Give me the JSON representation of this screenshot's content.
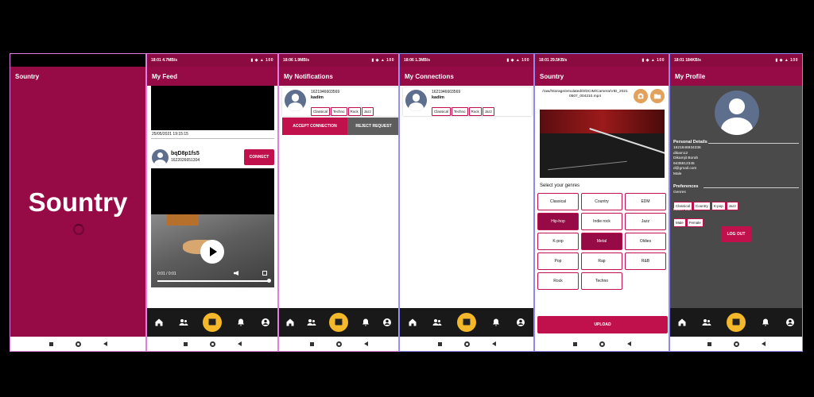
{
  "screens": {
    "splash": {
      "title": "Sountry",
      "logo": "Sountry"
    },
    "feed": {
      "status_time": "18:01",
      "status_speed": "4.7MB/s",
      "title": "My Feed",
      "post_date": "25/05/2021 19:15:15",
      "user_name": "bqD8p1fs5",
      "user_phone": "1622026651304",
      "connect_label": "CONNECT",
      "video_time": "0:01 / 0:01"
    },
    "notifications": {
      "status_time": "18:06",
      "status_speed": "1.9MB/s",
      "title": "My Notifications",
      "phone": "1621946603569",
      "name": "kadim",
      "genres": [
        "Classical",
        "Techno",
        "Rock",
        "Jazz"
      ],
      "accept_label": "ACCEPT CONNECTION",
      "reject_label": "REJECT REQUEST"
    },
    "connections": {
      "status_time": "18:06",
      "status_speed": "1.3MB/s",
      "title": "My Connections",
      "phone": "1621946603569",
      "name": "kadim",
      "genres": [
        "Classical",
        "Techno",
        "Rock",
        "Jazz"
      ]
    },
    "upload": {
      "status_time": "18:01",
      "status_speed": "29.5KB/s",
      "title": "Sountry",
      "file_path": "/raw//storage/emulated/0/DCIM/Camera/VID_20210507_004210.mp4",
      "select_label": "Select your genres",
      "genres": [
        {
          "label": "Classical",
          "selected": false
        },
        {
          "label": "Country",
          "selected": false
        },
        {
          "label": "EDM",
          "selected": false
        },
        {
          "label": "Hip-hop",
          "selected": true
        },
        {
          "label": "Indie rock",
          "selected": false
        },
        {
          "label": "Jazz",
          "selected": false
        },
        {
          "label": "K-pop",
          "selected": false
        },
        {
          "label": "Metal",
          "selected": true
        },
        {
          "label": "Oldies",
          "selected": false
        },
        {
          "label": "Pop",
          "selected": false
        },
        {
          "label": "Rap",
          "selected": false
        },
        {
          "label": "R&B",
          "selected": false
        },
        {
          "label": "Rock",
          "selected": false
        },
        {
          "label": "Techno",
          "selected": false
        }
      ],
      "upload_label": "UPLOAD"
    },
    "profile": {
      "status_time": "18:01",
      "status_speed": "184KB/s",
      "title": "My Profile",
      "personal_heading": "Personal Details",
      "details": [
        "1621846934336",
        "dikam12",
        "Dikamjit Borah",
        "9435812345",
        "d@gmail.com",
        "Male"
      ],
      "preferences_heading": "Preferences",
      "genres_label": "Genres",
      "genres": [
        "Classical",
        "Country",
        "K-pop",
        "Jazz"
      ],
      "match_label": "Match with",
      "match": [
        "Male",
        "Female"
      ],
      "logout_label": "LOG OUT"
    }
  },
  "nav_icons": [
    "home-icon",
    "people-icon",
    "upload-icon",
    "bell-icon",
    "account-icon"
  ],
  "colors": {
    "primary": "#960a45",
    "accent": "#c0114d",
    "center_button": "#f4b82b",
    "nav_bg": "#191919"
  }
}
